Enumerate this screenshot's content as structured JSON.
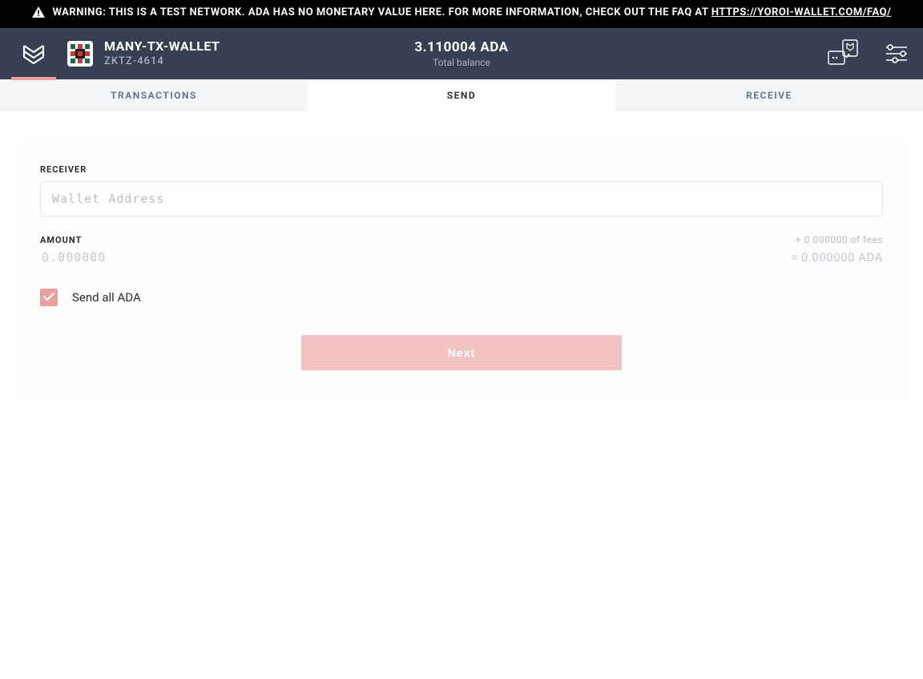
{
  "warning": {
    "prefix": "WARNING: THIS IS A TEST NETWORK. ADA HAS NO MONETARY VALUE HERE. FOR MORE INFORMATION, CHECK OUT THE FAQ AT ",
    "link_text": "HTTPS://YOROI-WALLET.COM/FAQ/"
  },
  "header": {
    "wallet_name": "MANY-TX-WALLET",
    "wallet_sub": "ZKTZ-4614",
    "balance_amount": "3.110004 ADA",
    "balance_label": "Total balance"
  },
  "tabs": {
    "transactions": "TRANSACTIONS",
    "send": "SEND",
    "receive": "RECEIVE"
  },
  "send_form": {
    "receiver_label": "RECEIVER",
    "receiver_placeholder": "Wallet Address",
    "amount_label": "AMOUNT",
    "fees_text": "+ 0.000000 of fees",
    "amount_placeholder": "0.000000",
    "amount_total": "= 0.000000 ADA",
    "send_all_label": "Send all ADA",
    "next_label": "Next"
  },
  "colors": {
    "accent": "#e9a1a0",
    "header_bg": "#373f52",
    "muted": "#b9bdc8"
  }
}
